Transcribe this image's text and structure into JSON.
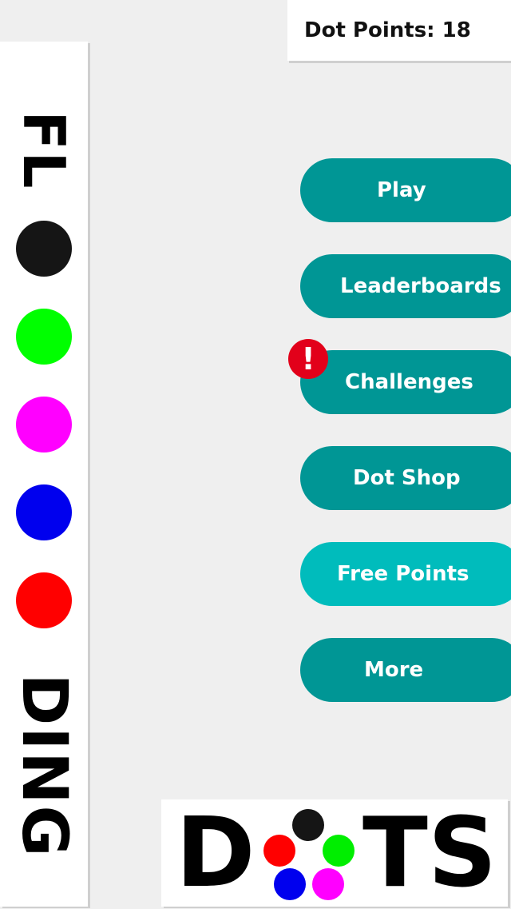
{
  "header": {
    "points_label": "Dot Points:",
    "points_value": "18"
  },
  "side_logo": {
    "top_text": "FL",
    "bottom_text": "DING",
    "dots": [
      {
        "name": "black-dot",
        "color": "#151515"
      },
      {
        "name": "green-dot",
        "color": "#00ff00"
      },
      {
        "name": "magenta-dot",
        "color": "#ff00ff"
      },
      {
        "name": "blue-dot",
        "color": "#0000ee"
      },
      {
        "name": "red-dot",
        "color": "#ff0000"
      }
    ]
  },
  "menu": {
    "play": "Play",
    "leaderboards": "Leaderboards",
    "challenges": "Challenges",
    "dot_shop": "Dot Shop",
    "free_points": "Free Points",
    "more": "More",
    "alert_symbol": "!"
  },
  "bottom_logo": {
    "letter_d": "D",
    "letters_ts": "TS",
    "dots": [
      {
        "name": "black",
        "color": "#151515"
      },
      {
        "name": "red",
        "color": "#ff0000"
      },
      {
        "name": "green",
        "color": "#00ee00"
      },
      {
        "name": "blue",
        "color": "#0000ee"
      },
      {
        "name": "magenta",
        "color": "#ff00ff"
      }
    ]
  },
  "colors": {
    "button": "#009695",
    "button_highlight": "#00bcbc",
    "alert": "#e2001a",
    "background": "#efefef"
  }
}
